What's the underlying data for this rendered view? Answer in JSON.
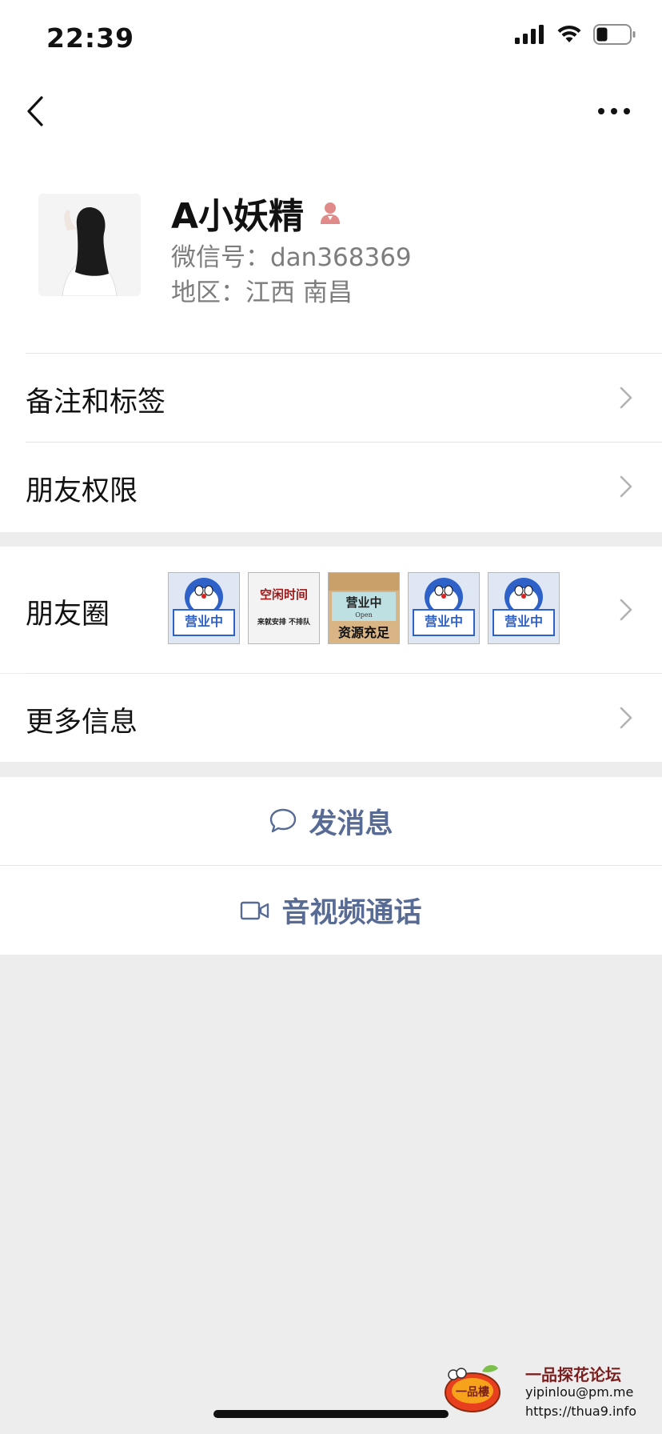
{
  "status_bar": {
    "time": "22:39",
    "icons": [
      "cellular-signal-icon",
      "wifi-icon",
      "battery-icon"
    ],
    "battery_level": 0.3
  },
  "nav": {
    "back_icon": "chevron-left-icon",
    "more_icon": "ellipsis-icon"
  },
  "profile": {
    "name": "A小妖精",
    "gender_icon": "female-user-icon",
    "wechat_id": "微信号：dan368369",
    "region": "地区：江西 南昌"
  },
  "rows": {
    "remarks_tags": "备注和标签",
    "friend_permissions": "朋友权限",
    "moments": "朋友圈",
    "more_info": "更多信息"
  },
  "moments_thumbs": [
    {
      "type": "doraemon-sign",
      "text": "营业中"
    },
    {
      "type": "text-card",
      "line1": "空闲时间",
      "line2": "来就安排 不排队"
    },
    {
      "type": "wood-sign",
      "line1": "营业中",
      "sub": "Open",
      "line2": "资源充足"
    },
    {
      "type": "doraemon-sign",
      "text": "营业中"
    },
    {
      "type": "doraemon-sign",
      "text": "营业中"
    }
  ],
  "actions": {
    "send_message": "发消息",
    "av_call": "音视频通话"
  },
  "watermark": {
    "title": "一品探花论坛",
    "email": "yipinlou@pm.me",
    "url": "https://thua9.info",
    "logo_text": "一品樓"
  },
  "colors": {
    "link_blue": "#576b95",
    "background_gray": "#ededed",
    "gender_icon_pink": "#e08a8a"
  }
}
